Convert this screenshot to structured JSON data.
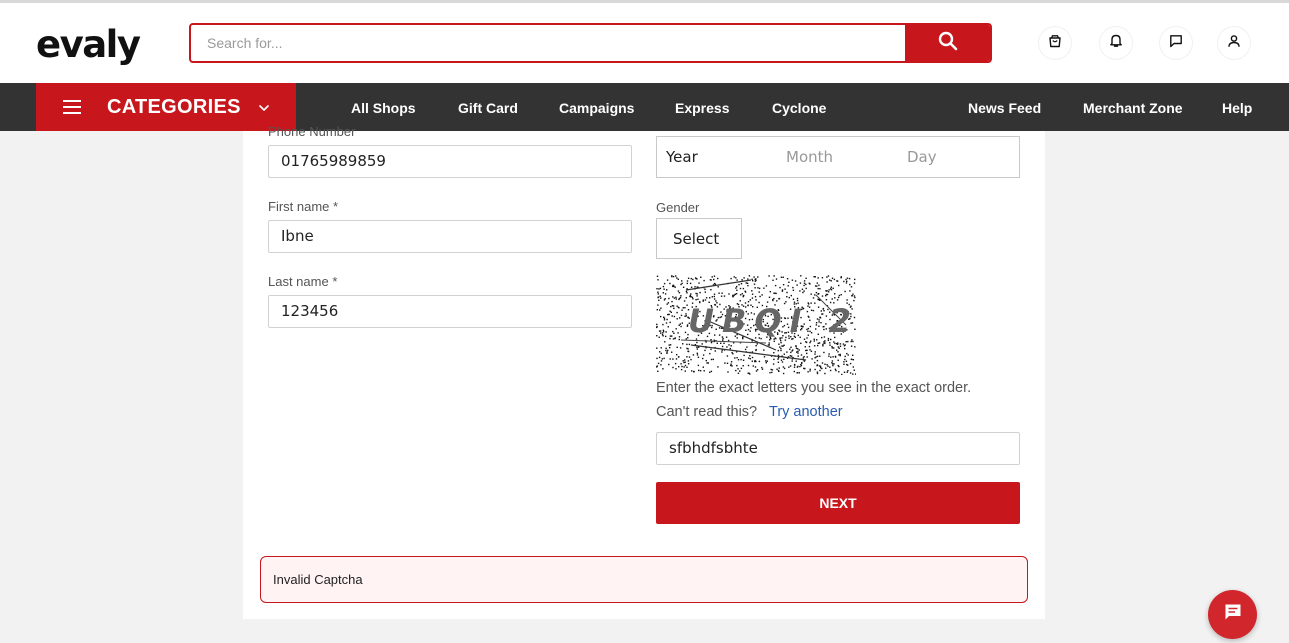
{
  "header": {
    "logo": "evaly",
    "search_placeholder": "Search for...",
    "icons": [
      "bag-icon",
      "bell-icon",
      "message-icon",
      "user-icon"
    ]
  },
  "nav": {
    "categories_label": "CATEGORIES",
    "links": [
      "All Shops",
      "Gift Card",
      "Campaigns",
      "Express",
      "Cyclone"
    ],
    "right_links": [
      "News Feed",
      "Merchant Zone",
      "Help"
    ]
  },
  "form": {
    "phone_label": "Phone Number",
    "phone_value": "01765989859",
    "first_name_label": "First name *",
    "first_name_value": "Ibne",
    "last_name_label": "Last name *",
    "last_name_value": "123456",
    "dob": {
      "year": "Year",
      "month": "Month",
      "day": "Day"
    },
    "gender_label": "Gender",
    "gender_value": "Select",
    "captcha_text": "UBQI 2",
    "captcha_instruction": "Enter the exact letters you see in the exact order.",
    "cant_read": "Can't read this?",
    "try_another": "Try another",
    "captcha_input_value": "sfbhdfsbhte",
    "next_button": "NEXT"
  },
  "alert": {
    "message": "Invalid Captcha"
  },
  "colors": {
    "brand_red": "#c8161d",
    "nav_bg": "#333333",
    "link_blue": "#2a5db0"
  }
}
